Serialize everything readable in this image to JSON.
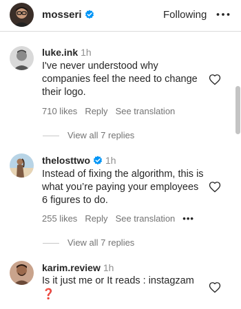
{
  "header": {
    "username": "mosseri",
    "follow_label": "Following",
    "more_icon": "more-horizontal-icon",
    "accent": "#0095f6"
  },
  "comments": [
    {
      "username": "luke.ink",
      "time": "1h",
      "text": "I've never understood why companies feel the need to change their logo.",
      "likes": "710 likes",
      "reply": "Reply",
      "translation": "See translation",
      "view_replies": "View all 7 replies"
    },
    {
      "username": "thelosttwo",
      "time": "1h",
      "verified": true,
      "text": "Instead of fixing the algorithm, this is what you’re paying your employees 6 figures to do.",
      "likes": "255 likes",
      "reply": "Reply",
      "translation": "See translation",
      "more": "•••",
      "view_replies": "View all 7 replies"
    },
    {
      "username": "karim.review",
      "time": "1h",
      "text": "Is it just me or It reads : instagzam",
      "emoji": "❓"
    }
  ]
}
